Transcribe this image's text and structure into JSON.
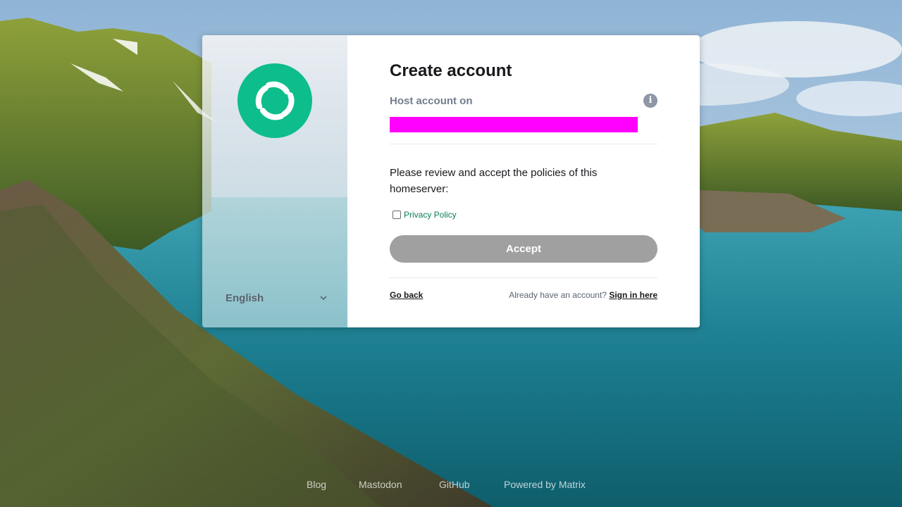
{
  "card": {
    "title": "Create account",
    "host_label": "Host account on",
    "info_icon": "info-icon",
    "policy_prompt": "Please review and accept the policies of this homeserver:",
    "policy_link": "Privacy Policy",
    "accept_label": "Accept",
    "go_back": "Go back",
    "already_text": "Already have an account?",
    "sign_in": "Sign in here"
  },
  "language": {
    "selected": "English",
    "icon": "chevron-down-icon"
  },
  "logo": {
    "name": "element-logo",
    "color": "#0dbd8b"
  },
  "host_redacted_color": "#ff00ff",
  "footer_links": [
    "Blog",
    "Mastodon",
    "GitHub",
    "Powered by Matrix"
  ]
}
